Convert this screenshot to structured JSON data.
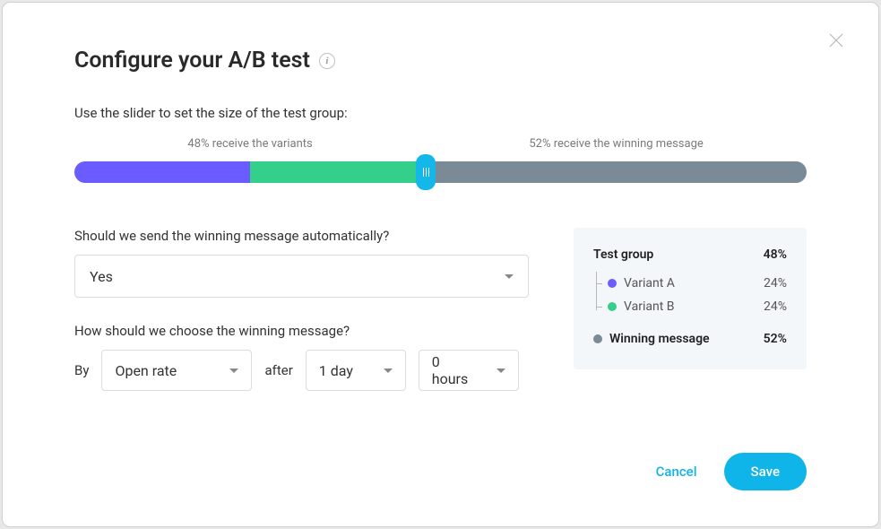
{
  "header": {
    "title": "Configure your A/B test"
  },
  "instruction": "Use the slider to set the size of the test group:",
  "slider": {
    "variants_pct": 48,
    "winning_pct": 52,
    "left_label": "48% receive the variants",
    "right_label": "52% receive the winning message",
    "variant_a_width": "24%",
    "variant_b_left": "24%",
    "variant_b_width": "24%",
    "winning_left": "48%",
    "handle_left": "48%"
  },
  "auto_send": {
    "question": "Should we send the winning message automatically?",
    "value": "Yes"
  },
  "winner": {
    "question": "How should we choose the winning message?",
    "by_prefix": "By",
    "metric": "Open rate",
    "after_prefix": "after",
    "days": "1 day",
    "hours": "0 hours"
  },
  "summary": {
    "test_group_label": "Test group",
    "test_group_pct": "48%",
    "variant_a_label": "Variant A",
    "variant_a_pct": "24%",
    "variant_b_label": "Variant B",
    "variant_b_pct": "24%",
    "winning_label": "Winning message",
    "winning_pct": "52%"
  },
  "footer": {
    "cancel": "Cancel",
    "save": "Save"
  }
}
